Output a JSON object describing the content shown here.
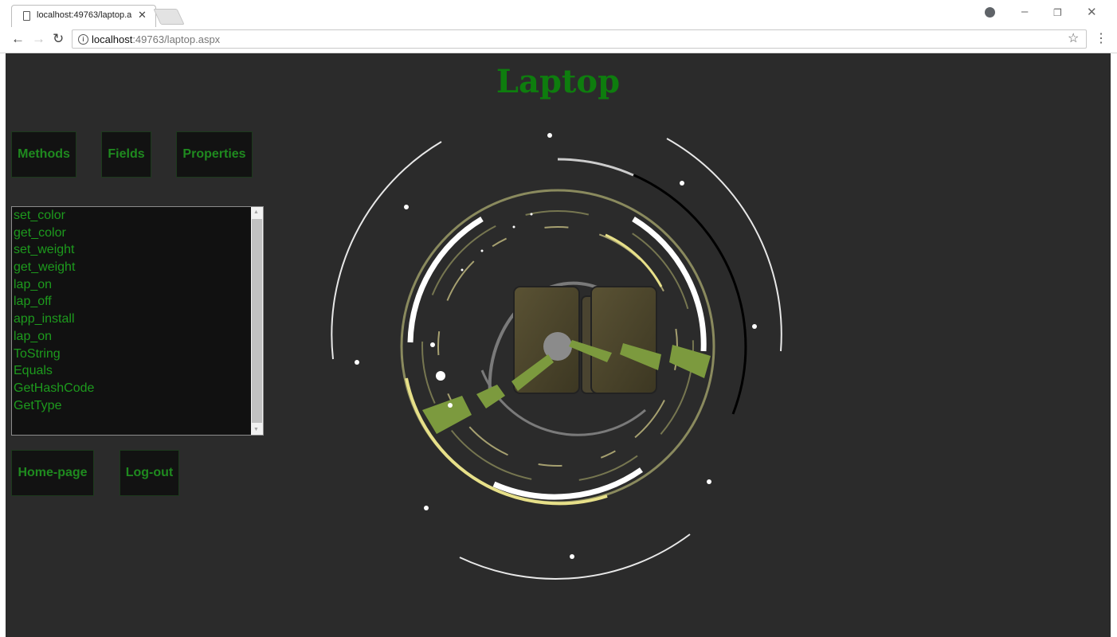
{
  "browser": {
    "tab_title": "localhost:49763/laptop.a",
    "url_host": "localhost",
    "url_rest": ":49763/laptop.aspx",
    "info_glyph": "i",
    "icons": [
      "page-icon",
      "close-icon",
      "profile-icon",
      "minimize-icon",
      "restore-icon",
      "window-close-icon",
      "back-icon",
      "forward-icon",
      "reload-icon",
      "info-icon",
      "star-icon",
      "menu-icon"
    ]
  },
  "page": {
    "title": "Laptop",
    "colors": {
      "background": "#2b2b2b",
      "accent": "#1f8a1f",
      "title": "#0e7d0e"
    },
    "buttons": {
      "methods": "Methods",
      "fields": "Fields",
      "properties": "Properties",
      "home": "Home-page",
      "logout": "Log-out"
    },
    "list_items": [
      "set_color",
      "get_color",
      "set_weight",
      "get_weight",
      "lap_on",
      "lap_off",
      "app_install",
      "lap_on",
      "ToString",
      "Equals",
      "GetHashCode",
      "GetType"
    ]
  }
}
